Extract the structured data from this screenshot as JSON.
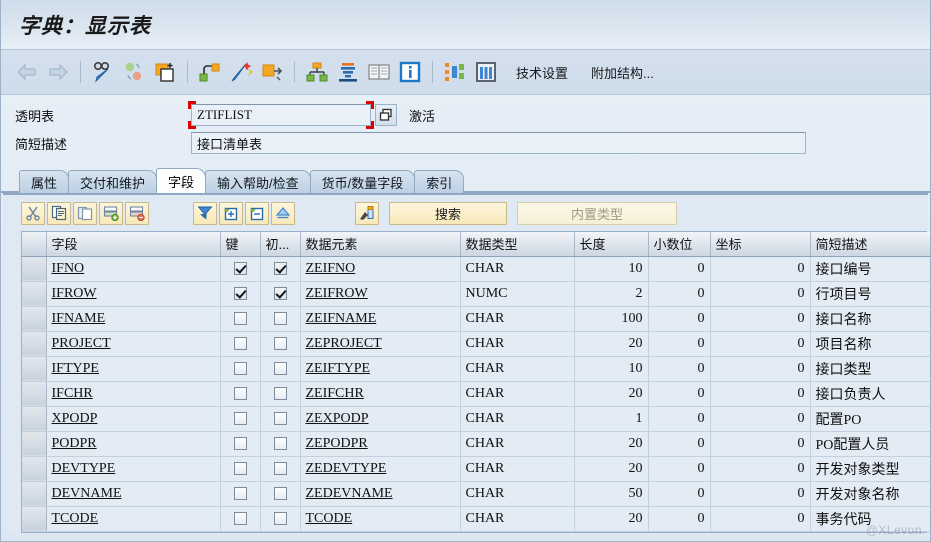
{
  "window": {
    "title": "字典：显示表"
  },
  "toolbar": {
    "icons": [
      {
        "name": "back-arrow-icon",
        "label": "后退"
      },
      {
        "name": "forward-arrow-icon",
        "label": "前进"
      },
      {
        "name": "display-change-icon",
        "label": "显示<->修改"
      },
      {
        "name": "refresh-toggle-icon",
        "label": "切换"
      },
      {
        "name": "copy-object-icon",
        "label": "复制"
      },
      {
        "name": "where-used-icon",
        "label": "使用位置"
      },
      {
        "name": "magic-wand-icon",
        "label": "生成"
      },
      {
        "name": "expand-object-icon",
        "label": "展开"
      },
      {
        "name": "hierarchy-icon",
        "label": "层次"
      },
      {
        "name": "database-stack-icon",
        "label": "数据库对象"
      },
      {
        "name": "documentation-icon",
        "label": "文档"
      },
      {
        "name": "info-icon",
        "label": "信息"
      },
      {
        "name": "structure-view-icon",
        "label": "结构显示"
      },
      {
        "name": "table-columns-icon",
        "label": "表列"
      }
    ],
    "text_buttons": [
      {
        "name": "technical-settings-button",
        "label": "技术设置"
      },
      {
        "name": "append-structure-button",
        "label": "附加结构..."
      }
    ]
  },
  "header_fields": {
    "table_label": "透明表",
    "table_value": "ZTIFLIST",
    "table_status": "激活",
    "desc_label": "简短描述",
    "desc_value": "接口清单表"
  },
  "tabs": [
    {
      "label": "属性",
      "active": false
    },
    {
      "label": "交付和维护",
      "active": false
    },
    {
      "label": "字段",
      "active": true
    },
    {
      "label": "输入帮助/检查",
      "active": false
    },
    {
      "label": "货币/数量字段",
      "active": false
    },
    {
      "label": "索引",
      "active": false
    }
  ],
  "grid_toolbar": {
    "icons": [
      {
        "name": "cut-icon",
        "label": "剪切"
      },
      {
        "name": "copy-icon",
        "label": "复制"
      },
      {
        "name": "paste-icon",
        "label": "粘贴"
      },
      {
        "name": "insert-row-icon",
        "label": "插入行"
      },
      {
        "name": "delete-row-icon",
        "label": "删除行"
      },
      {
        "name": "sort-filter-icon",
        "label": "筛选"
      },
      {
        "name": "expand-all-icon",
        "label": "全部展开"
      },
      {
        "name": "collapse-all-icon",
        "label": "全部折叠"
      },
      {
        "name": "up-arrow-icon",
        "label": "向上"
      },
      {
        "name": "predefined-type-icon",
        "label": "数据元素"
      }
    ],
    "search_button": "搜索",
    "builtin_type_button": "内置类型"
  },
  "table": {
    "columns": [
      {
        "key": "field",
        "label": "字段"
      },
      {
        "key": "key",
        "label": "键"
      },
      {
        "key": "init",
        "label": "初..."
      },
      {
        "key": "data_element",
        "label": "数据元素"
      },
      {
        "key": "data_type",
        "label": "数据类型"
      },
      {
        "key": "length",
        "label": "长度"
      },
      {
        "key": "decimals",
        "label": "小数位"
      },
      {
        "key": "coord",
        "label": "坐标"
      },
      {
        "key": "short_desc",
        "label": "简短描述"
      }
    ],
    "rows": [
      {
        "field": "IFNO",
        "key": true,
        "init": true,
        "data_element": "ZEIFNO",
        "data_type": "CHAR",
        "length": "10",
        "decimals": "0",
        "coord": "0",
        "short_desc": "接口编号"
      },
      {
        "field": "IFROW",
        "key": true,
        "init": true,
        "data_element": "ZEIFROW",
        "data_type": "NUMC",
        "length": "2",
        "decimals": "0",
        "coord": "0",
        "short_desc": "行项目号"
      },
      {
        "field": "IFNAME",
        "key": false,
        "init": false,
        "data_element": "ZEIFNAME",
        "data_type": "CHAR",
        "length": "100",
        "decimals": "0",
        "coord": "0",
        "short_desc": "接口名称"
      },
      {
        "field": "PROJECT",
        "key": false,
        "init": false,
        "data_element": "ZEPROJECT",
        "data_type": "CHAR",
        "length": "20",
        "decimals": "0",
        "coord": "0",
        "short_desc": "项目名称"
      },
      {
        "field": "IFTYPE",
        "key": false,
        "init": false,
        "data_element": "ZEIFTYPE",
        "data_type": "CHAR",
        "length": "10",
        "decimals": "0",
        "coord": "0",
        "short_desc": "接口类型"
      },
      {
        "field": "IFCHR",
        "key": false,
        "init": false,
        "data_element": "ZEIFCHR",
        "data_type": "CHAR",
        "length": "20",
        "decimals": "0",
        "coord": "0",
        "short_desc": "接口负责人"
      },
      {
        "field": "XPODP",
        "key": false,
        "init": false,
        "data_element": "ZEXPODP",
        "data_type": "CHAR",
        "length": "1",
        "decimals": "0",
        "coord": "0",
        "short_desc": "配置PO"
      },
      {
        "field": "PODPR",
        "key": false,
        "init": false,
        "data_element": "ZEPODPR",
        "data_type": "CHAR",
        "length": "20",
        "decimals": "0",
        "coord": "0",
        "short_desc": "PO配置人员"
      },
      {
        "field": "DEVTYPE",
        "key": false,
        "init": false,
        "data_element": "ZEDEVTYPE",
        "data_type": "CHAR",
        "length": "20",
        "decimals": "0",
        "coord": "0",
        "short_desc": "开发对象类型"
      },
      {
        "field": "DEVNAME",
        "key": false,
        "init": false,
        "data_element": "ZEDEVNAME",
        "data_type": "CHAR",
        "length": "50",
        "decimals": "0",
        "coord": "0",
        "short_desc": "开发对象名称"
      },
      {
        "field": "TCODE",
        "key": false,
        "init": false,
        "data_element": "TCODE",
        "data_type": "CHAR",
        "length": "20",
        "decimals": "0",
        "coord": "0",
        "short_desc": "事务代码"
      }
    ]
  },
  "watermark": "@XLevon",
  "colors": {
    "accent": "#2b6cb0",
    "highlight_marker": "#e00000",
    "button_yellow": "#f7e9b9",
    "grid_row_bg": "#e3ecf5"
  }
}
